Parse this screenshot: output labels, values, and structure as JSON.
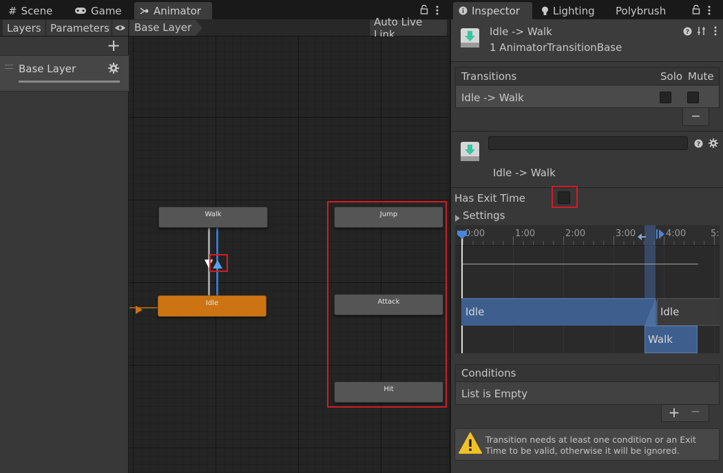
{
  "scene_panel": {
    "tabs": [
      {
        "label": "Scene",
        "icon": "grid-icon"
      },
      {
        "label": "Game",
        "icon": "gamepad-icon"
      },
      {
        "label": "Animator",
        "icon": "animator-icon"
      }
    ],
    "toolbar": {
      "layers_label": "Layers",
      "parameters_label": "Parameters",
      "breadcrumb_label": "Base Layer",
      "auto_live_link_label": "Auto Live Link"
    },
    "layers": {
      "add_label": "+",
      "item_label": "Base Layer"
    },
    "nodes": {
      "walk": "Walk",
      "idle": "Idle",
      "jump": "Jump",
      "attack": "Attack",
      "hit": "Hit"
    }
  },
  "inspector": {
    "tabs": [
      {
        "label": "Inspector",
        "icon": "info-icon"
      },
      {
        "label": "Lighting",
        "icon": "bulb-icon"
      },
      {
        "label": "Polybrush",
        "icon": ""
      }
    ],
    "header": {
      "title": "Idle -> Walk",
      "subtitle": "1 AnimatorTransitionBase"
    },
    "transitions": {
      "header_label": "Transitions",
      "solo_label": "Solo",
      "mute_label": "Mute",
      "rows": [
        {
          "label": "Idle -> Walk",
          "solo": false,
          "mute": false
        }
      ],
      "remove_label": "−"
    },
    "transition": {
      "name_value": "",
      "title": "Idle -> Walk",
      "has_exit_time_label": "Has Exit Time",
      "has_exit_time": false,
      "settings_label": "Settings"
    },
    "timeline": {
      "ticks": [
        "0:00",
        "1:00",
        "2:00",
        "3:00",
        "4:00",
        "5:"
      ],
      "idle_label": "Idle",
      "idle2_label": "Idle",
      "walk_label": "Walk"
    },
    "conditions": {
      "header_label": "Conditions",
      "empty_label": "List is Empty",
      "add_label": "+",
      "remove_label": "−"
    },
    "warning": {
      "line1": "Transition needs at least one condition or an Exit",
      "line2": "Time to be valid, otherwise it will be ignored."
    }
  },
  "colors": {
    "accent_blue": "#4a6fa5",
    "node_orange": "#cc7414",
    "highlight_red": "#d51c24",
    "warning_yellow": "#f2c124"
  }
}
